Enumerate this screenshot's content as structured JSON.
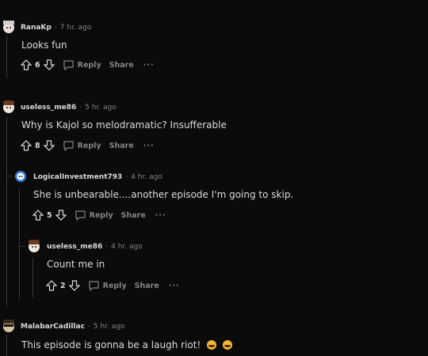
{
  "comments": [
    {
      "user": "RanaKp",
      "sep": "·",
      "time": "7 hr. ago",
      "text": "Looks fun",
      "votes": "6",
      "reply": "Reply",
      "share": "Share",
      "more": "···"
    },
    {
      "user": "useless_me86",
      "sep": "·",
      "time": "5 hr. ago",
      "text": "Why is Kajol so melodramatic? Insufferable",
      "votes": "8",
      "reply": "Reply",
      "share": "Share",
      "more": "···"
    },
    {
      "user": "LogicalInvestment793",
      "sep": "·",
      "time": "4 hr. ago",
      "text": "She is unbearable....another episode I'm going to skip.",
      "votes": "5",
      "reply": "Reply",
      "share": "Share",
      "more": "···"
    },
    {
      "user": "useless_me86",
      "sep": "·",
      "time": "4 hr. ago",
      "text": "Count me in",
      "votes": "2",
      "reply": "Reply",
      "share": "Share",
      "more": "···"
    },
    {
      "user": "MalabarCadillac",
      "sep": "·",
      "time": "5 hr. ago",
      "text": "This episode is gonna be a laugh riot!",
      "emoji": "rolling-on-floor-laughing"
    }
  ],
  "colors": {
    "background": "#0b0b0b",
    "text": "#d7dadc",
    "muted": "#818384",
    "thread": "#343536"
  }
}
